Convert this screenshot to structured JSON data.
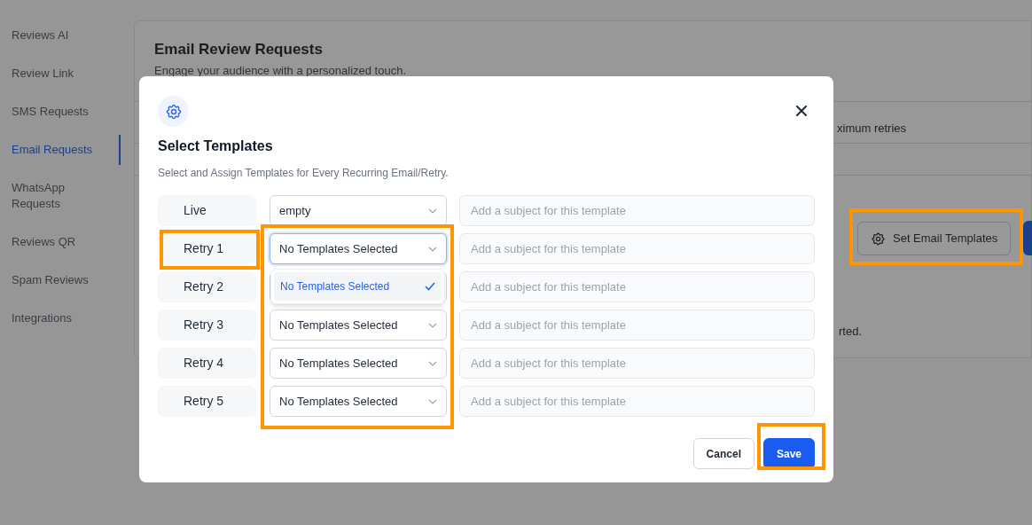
{
  "sidebar": {
    "items": [
      {
        "label": "Reviews AI",
        "selected": false
      },
      {
        "label": "Review Link",
        "selected": false
      },
      {
        "label": "SMS Requests",
        "selected": false
      },
      {
        "label": "Email Requests",
        "selected": true
      },
      {
        "label": "WhatsApp Requests",
        "selected": false
      },
      {
        "label": "Reviews QR",
        "selected": false
      },
      {
        "label": "Spam Reviews",
        "selected": false
      },
      {
        "label": "Integrations",
        "selected": false
      }
    ]
  },
  "page": {
    "title": "Email Review Requests",
    "subtitle": "Engage your audience with a personalized touch.",
    "column_text": "ximum retries",
    "button": "Set Email Templates",
    "note_text": "rted."
  },
  "modal": {
    "title": "Select Templates",
    "subtitle": "Select and Assign Templates for Every Recurring Email/Retry.",
    "rows": [
      {
        "label": "Live",
        "template": "empty",
        "subject_placeholder": "Add a subject for this template",
        "focused": false
      },
      {
        "label": "Retry 1",
        "template": "No Templates Selected",
        "subject_placeholder": "Add a subject for this template",
        "focused": true
      },
      {
        "label": "Retry 2",
        "subject_placeholder": "Add a subject for this template",
        "focused": false
      },
      {
        "label": "Retry 3",
        "template": "No Templates Selected",
        "subject_placeholder": "Add a subject for this template",
        "focused": false
      },
      {
        "label": "Retry 4",
        "template": "No Templates Selected",
        "subject_placeholder": "Add a subject for this template",
        "focused": false
      },
      {
        "label": "Retry 5",
        "template": "No Templates Selected",
        "subject_placeholder": "Add a subject for this template",
        "focused": false
      }
    ],
    "dropdown": {
      "options": [
        {
          "label": "No Templates Selected",
          "selected": true
        }
      ]
    },
    "buttons": [
      {
        "label": "Cancel",
        "kind": "secondary"
      },
      {
        "label": "Save",
        "kind": "primary"
      }
    ]
  }
}
